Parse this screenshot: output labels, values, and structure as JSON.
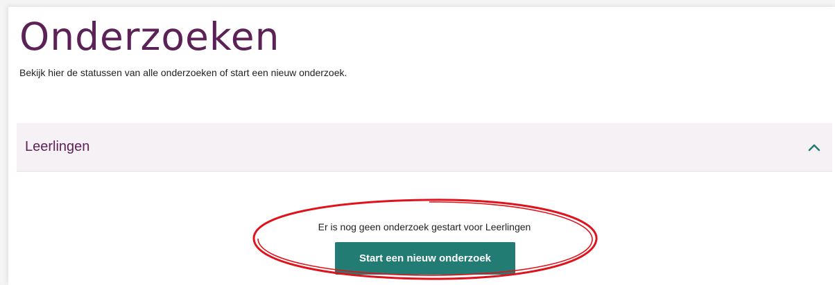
{
  "page": {
    "title": "Onderzoeken",
    "subtitle": "Bekijk hier de statussen van alle onderzoeken of start een nieuw onderzoek."
  },
  "accordion": {
    "title": "Leerlingen",
    "expanded": true,
    "toggle_icon": "chevron-up-icon",
    "empty_message": "Er is nog geen onderzoek gestart voor Leerlingen",
    "start_button_label": "Start een nieuw onderzoek"
  },
  "annotation": {
    "shape": "ellipse",
    "color": "#e0121b"
  },
  "colors": {
    "brand_purple": "#5c2257",
    "accent_teal": "#237c73",
    "header_background": "#f6f1f5"
  }
}
